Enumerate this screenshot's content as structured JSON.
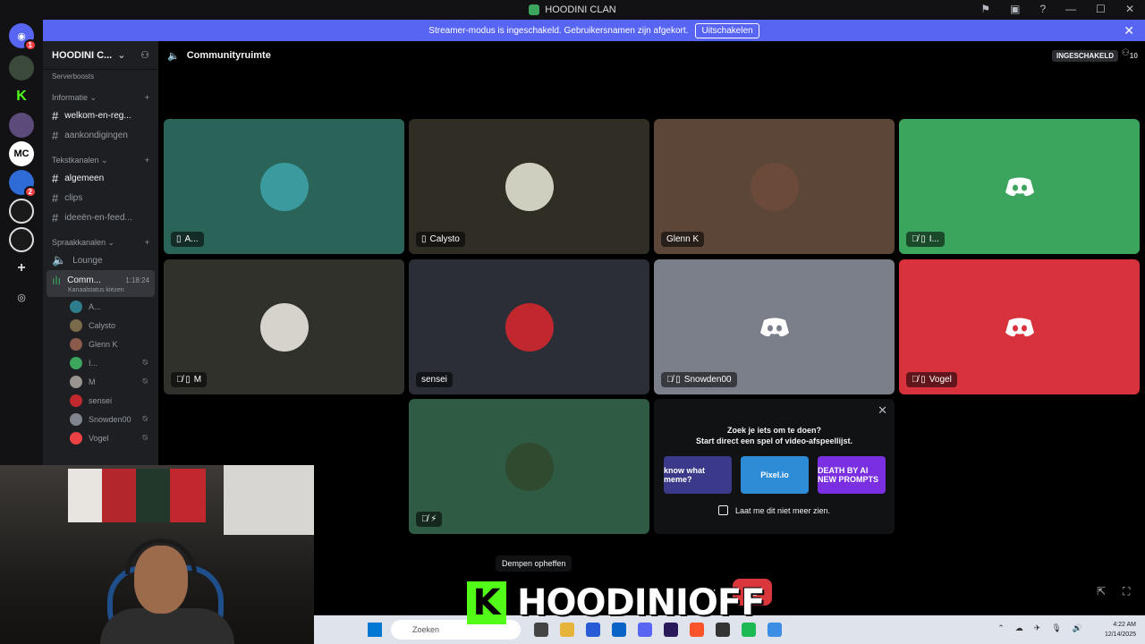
{
  "window": {
    "title": "HOODINI CLAN"
  },
  "banner": {
    "text": "Streamer-modus is ingeschakeld. Gebruikersnamen zijn afgekort.",
    "button": "Uitschakelen"
  },
  "server": {
    "name": "HOODINI C...",
    "boosts_partial": "Serverboosts"
  },
  "server_rail": [
    {
      "name": "discord-home",
      "badge": "1"
    },
    {
      "name": "user-server",
      "badge": ""
    },
    {
      "name": "kick-server",
      "badge": ""
    },
    {
      "name": "anime-server",
      "badge": ""
    },
    {
      "name": "mc-server",
      "label": "MC",
      "badge": ""
    },
    {
      "name": "blue-server",
      "badge": "2"
    },
    {
      "name": "tl-server",
      "badge": ""
    },
    {
      "name": "tsm-server",
      "badge": ""
    }
  ],
  "sidebar": {
    "categories": {
      "info": "Informatie",
      "text": "Tekstkanalen",
      "voice": "Spraakkanalen"
    },
    "info_channels": [
      "welkom-en-reg...",
      "aankondigingen"
    ],
    "text_channels": [
      "algemeen",
      "clips",
      "ideeën-en-feed..."
    ],
    "voice_channels": [
      {
        "name": "Lounge"
      },
      {
        "name": "Comm...",
        "timer": "1:18:24",
        "status": "Kanaalstatus kiezen"
      }
    ],
    "voice_users": [
      {
        "name": "A...",
        "muted": false,
        "color": "#2e7d8c"
      },
      {
        "name": "Calysto",
        "muted": false,
        "color": "#7a6b4a"
      },
      {
        "name": "Glenn K",
        "muted": false,
        "color": "#8a5a4a"
      },
      {
        "name": "I...",
        "muted": true,
        "color": "#3ba55d"
      },
      {
        "name": "M",
        "muted": true,
        "color": "#9a9490"
      },
      {
        "name": "sensei",
        "muted": false,
        "color": "#c0282e"
      },
      {
        "name": "Snowden00",
        "muted": true,
        "color": "#80848e"
      },
      {
        "name": "Vogel",
        "muted": true,
        "color": "#ed4245"
      }
    ]
  },
  "topbar": {
    "channel": "Communityruimte",
    "enabled_pill": "INGESCHAKELD",
    "member_count": "10"
  },
  "tiles": [
    {
      "name": "A...",
      "bg": "#2a6358",
      "type": "avatar",
      "avatar_color": "#3a9a9e",
      "icons": "▯"
    },
    {
      "name": "Calysto",
      "bg": "#2f2d24",
      "type": "avatar",
      "avatar_color": "#cfcfbf",
      "icons": "▯"
    },
    {
      "name": "Glenn K",
      "bg": "#5c4638",
      "type": "avatar",
      "avatar_color": "#6b4a3a",
      "icons": ""
    },
    {
      "name": "I...",
      "bg": "#3ba55d",
      "type": "discord",
      "icons": "🎙̸ ▯"
    },
    {
      "name": "M",
      "bg": "#30312b",
      "type": "avatar",
      "avatar_color": "#d6d2cc",
      "icons": "🎙̸ ▯"
    },
    {
      "name": "sensei",
      "bg": "#2b2e36",
      "type": "avatar",
      "avatar_color": "#c0282e",
      "icons": ""
    },
    {
      "name": "Snowden00",
      "bg": "#7b7f89",
      "type": "discord",
      "icons": "🎙̸ ▯"
    },
    {
      "name": "Vogel",
      "bg": "#d8323d",
      "type": "discord",
      "icons": "🎙̸ ▯"
    },
    {
      "name": "",
      "bg": "#2f5a44",
      "type": "avatar",
      "avatar_color": "#2f4a2f",
      "icons": "🎙̸ ⚡"
    }
  ],
  "promo": {
    "line1": "Zoek je iets om te doen?",
    "line2": "Start direct een spel of video-afspeellijst.",
    "games": [
      {
        "label": "know what meme?",
        "color": "#3b3a8a"
      },
      {
        "label": "Pixel.io",
        "color": "#2e8bd6"
      },
      {
        "label": "DEATH BY AI NEW PROMPTS",
        "color": "#7a2fe0"
      }
    ],
    "checkbox": "Laat me dit niet meer zien."
  },
  "call": {
    "tooltip": "Dempen opheffen"
  },
  "overlay": {
    "name": "HOODINIOFF",
    "logo_letter": "K"
  },
  "taskbar": {
    "search_placeholder": "Zoeken",
    "time": "4:22 AM",
    "date": "12/14/2025"
  },
  "colors": {
    "accent": "#5865f2",
    "danger": "#da373c",
    "kick_green": "#53fc18"
  }
}
